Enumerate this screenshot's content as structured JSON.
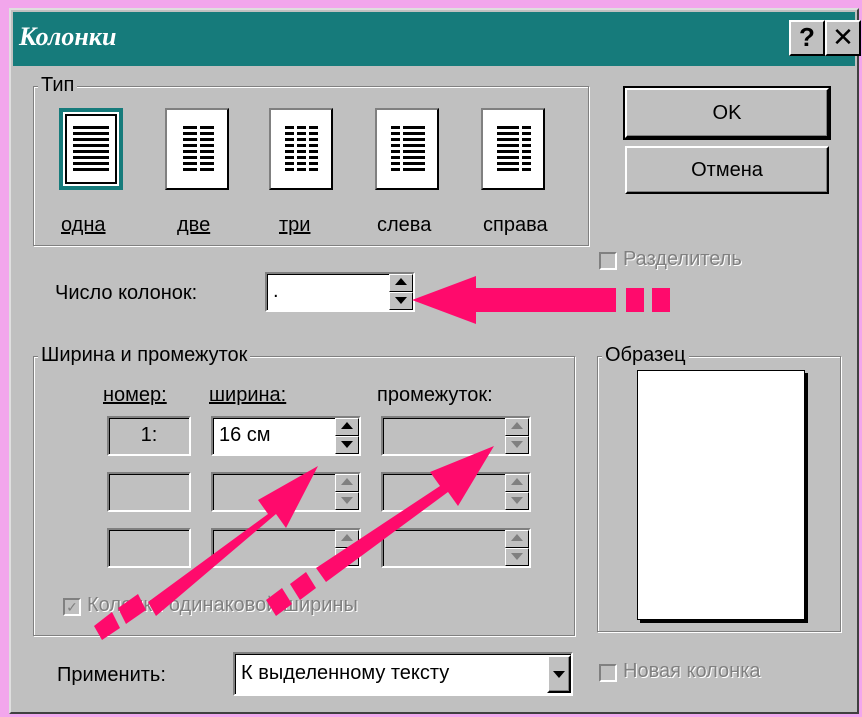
{
  "title": "Колонки",
  "titlebar": {
    "help": "?",
    "close": "✕"
  },
  "buttons": {
    "ok": "OK",
    "cancel": "Отмена"
  },
  "type_group": {
    "title": "Тип",
    "presets": [
      {
        "label": "одна",
        "selected": true
      },
      {
        "label": "две",
        "selected": false
      },
      {
        "label": "три",
        "selected": false
      },
      {
        "label": "слева",
        "selected": false
      },
      {
        "label": "справа",
        "selected": false
      }
    ]
  },
  "separator": {
    "label": "Разделитель"
  },
  "columns_count": {
    "label": "Число колонок:",
    "value": "."
  },
  "width_group": {
    "title": "Ширина и промежуток",
    "col_number": "номер:",
    "col_width": "ширина:",
    "col_gap": "промежуток:",
    "rows": [
      {
        "number": "1:",
        "width": "16 см",
        "gap": ""
      },
      {
        "number": "",
        "width": "",
        "gap": ""
      },
      {
        "number": "",
        "width": "",
        "gap": ""
      }
    ]
  },
  "equal_width": {
    "label": "Колонки одинаковой ширины"
  },
  "sample": {
    "title": "Образец"
  },
  "apply": {
    "label": "Применить:",
    "value": "К выделенному тексту"
  },
  "new_column": {
    "label": "Новая колонка"
  },
  "colors": {
    "titlebar": "#167b7b",
    "arrow": "#ff0a6c",
    "dialog": "#c0c0c0",
    "page": "#f2a6ec"
  }
}
